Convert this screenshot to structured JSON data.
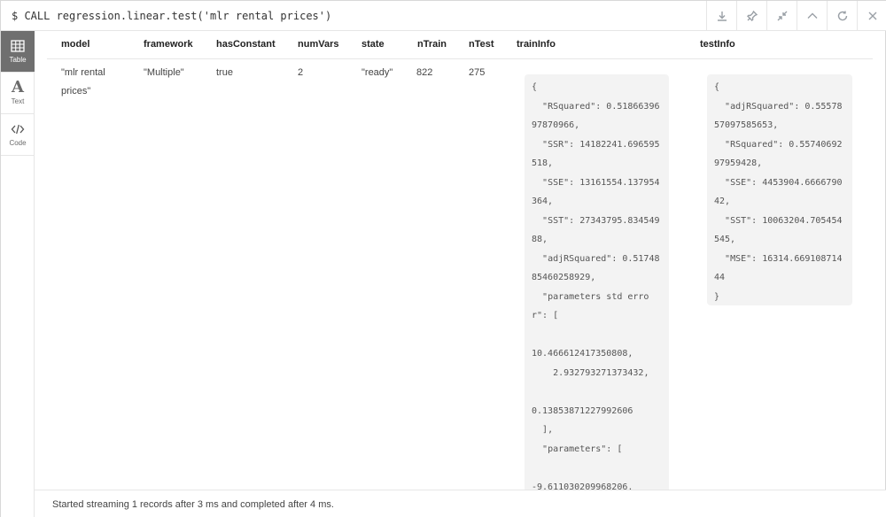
{
  "command": "$ CALL regression.linear.test('mlr rental prices')",
  "toolbar": {
    "icons": [
      "download-icon",
      "pin-icon",
      "collapse-icon",
      "chevron-up-icon",
      "refresh-icon",
      "close-icon"
    ]
  },
  "views": [
    {
      "label": "Table",
      "icon": "table-icon",
      "active": true
    },
    {
      "label": "Text",
      "icon": "text-icon",
      "active": false
    },
    {
      "label": "Code",
      "icon": "code-icon",
      "active": false
    }
  ],
  "table": {
    "columns": [
      "model",
      "framework",
      "hasConstant",
      "numVars",
      "state",
      "nTrain",
      "nTest",
      "trainInfo",
      "testInfo"
    ],
    "row": {
      "model": "\"mlr rental prices\"",
      "framework": "\"Multiple\"",
      "hasConstant": "true",
      "numVars": "2",
      "state": "\"ready\"",
      "nTrain": "822",
      "nTest": "275",
      "trainInfo": "{\n  \"RSquared\": 0.5186639697870966,\n  \"SSR\": 14182241.696595518,\n  \"SSE\": 13161554.137954364,\n  \"SST\": 27343795.83454988,\n  \"adjRSquared\": 0.5174885460258929,\n  \"parameters std error\": [\n\n10.466612417350808,\n    2.932793271373432,\n\n0.13853871227992606\n  ],\n  \"parameters\": [\n\n-9.611030209968206,",
      "testInfo": "{\n  \"adjRSquared\": 0.5557857097585653,\n  \"RSquared\": 0.5574069297959428,\n  \"SSE\": 4453904.666679042,\n  \"SST\": 10063204.705454545,\n  \"MSE\": 16314.66910871444\n}"
    }
  },
  "status": "Started streaming 1 records after 3 ms and completed after 4 ms."
}
